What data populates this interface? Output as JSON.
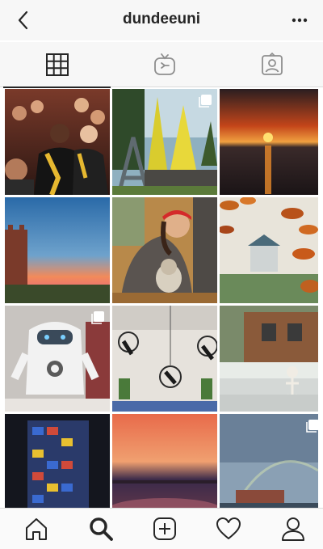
{
  "header": {
    "username": "dundeeuni",
    "back_icon": "chevron-left-icon",
    "more_icon": "more-horizontal-icon"
  },
  "tabs": [
    {
      "icon": "grid-icon",
      "active": true
    },
    {
      "icon": "igtv-icon",
      "active": false
    },
    {
      "icon": "tagged-icon",
      "active": false
    }
  ],
  "posts": [
    {
      "subject": "graduation-ceremony",
      "multi": false
    },
    {
      "subject": "yellow-trees-sculpture",
      "multi": true
    },
    {
      "subject": "sunset-over-water",
      "multi": false
    },
    {
      "subject": "tower-at-dusk",
      "multi": false
    },
    {
      "subject": "student-with-dog",
      "multi": false
    },
    {
      "subject": "autumn-bandstand",
      "multi": false
    },
    {
      "subject": "robot-exhibit",
      "multi": true
    },
    {
      "subject": "aerial-hoop-studio",
      "multi": false
    },
    {
      "subject": "skeleton-at-window",
      "multi": false
    },
    {
      "subject": "lit-building-night",
      "multi": false
    },
    {
      "subject": "pink-sunset-shore",
      "multi": false
    },
    {
      "subject": "rainbow-sky",
      "multi": true
    }
  ],
  "bottom_nav": [
    {
      "icon": "home-icon",
      "active": false
    },
    {
      "icon": "search-icon",
      "active": true
    },
    {
      "icon": "add-post-icon",
      "active": false
    },
    {
      "icon": "heart-icon",
      "active": false
    },
    {
      "icon": "profile-icon",
      "active": false
    }
  ],
  "colors": {
    "bar_background": "#f7f7f7",
    "text": "#262626",
    "divider": "#dbdbdb"
  }
}
